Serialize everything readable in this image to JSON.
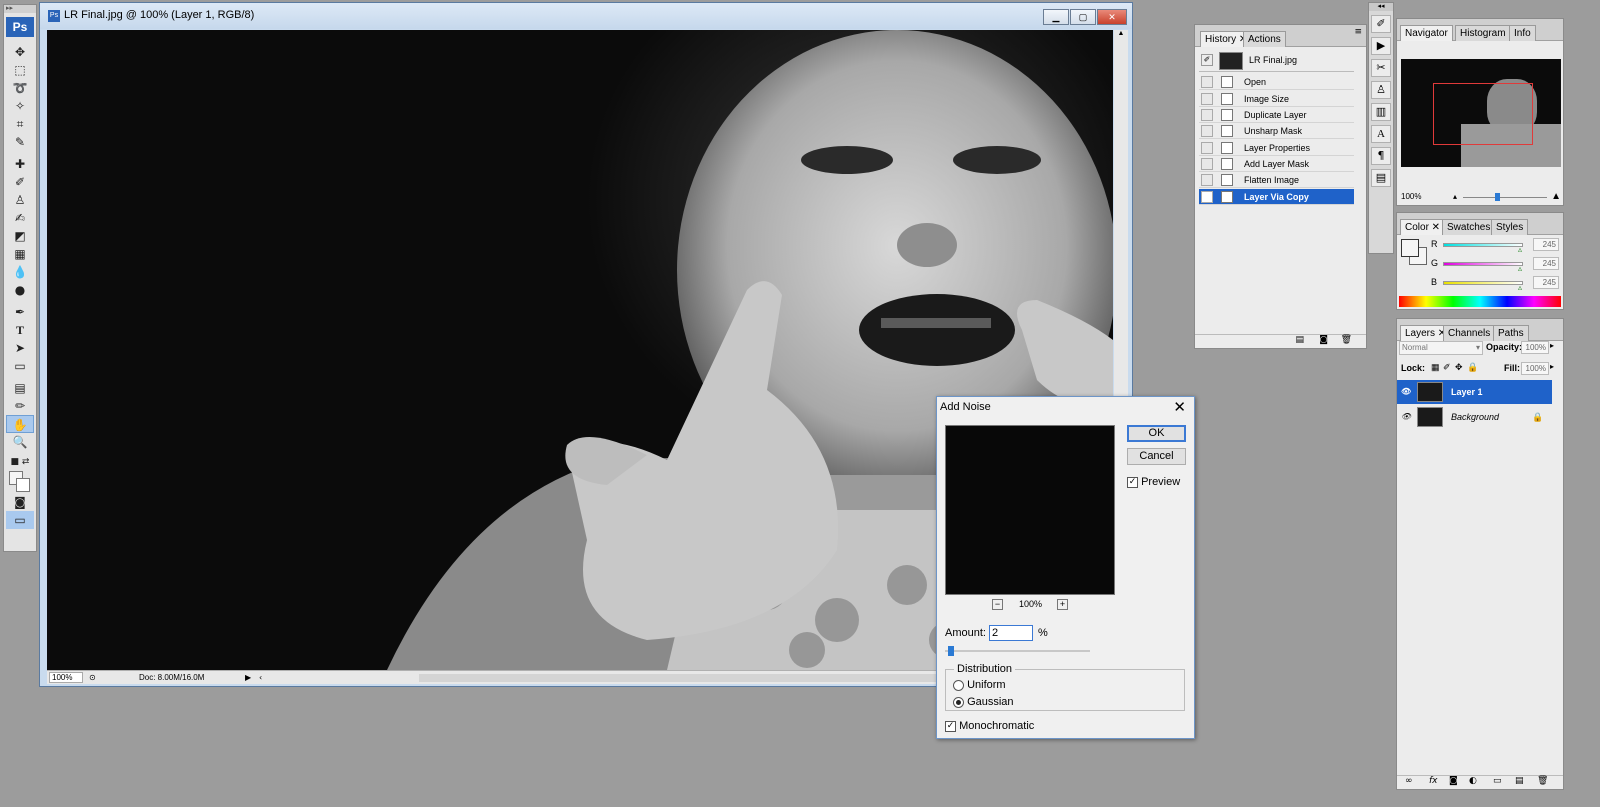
{
  "toolbox": {
    "logo": "Ps",
    "tools": [
      "move",
      "marquee",
      "lasso",
      "magic-wand",
      "crop",
      "slice",
      "healing",
      "brush",
      "stamp",
      "history-brush",
      "eraser",
      "gradient",
      "blur",
      "dodge",
      "pen",
      "type",
      "path-select",
      "shape",
      "notes",
      "eyedropper",
      "hand",
      "zoom"
    ]
  },
  "document": {
    "title": "LR Final.jpg @ 100% (Layer 1, RGB/8)",
    "zoom": "100%",
    "doc_info": "Doc: 8.00M/16.0M"
  },
  "history": {
    "tabs": [
      "History",
      "Actions"
    ],
    "snapshot": "LR Final.jpg",
    "items": [
      {
        "label": "Open",
        "selected": false
      },
      {
        "label": "Image Size",
        "selected": false
      },
      {
        "label": "Duplicate Layer",
        "selected": false
      },
      {
        "label": "Unsharp Mask",
        "selected": false
      },
      {
        "label": "Layer Properties",
        "selected": false
      },
      {
        "label": "Add Layer Mask",
        "selected": false
      },
      {
        "label": "Flatten Image",
        "selected": false
      },
      {
        "label": "Layer Via Copy",
        "selected": true
      }
    ]
  },
  "dialog": {
    "title": "Add Noise",
    "ok": "OK",
    "cancel": "Cancel",
    "preview_label": "Preview",
    "preview_checked": true,
    "preview_zoom": "100%",
    "amount_label": "Amount:",
    "amount_value": "2",
    "amount_unit": "%",
    "distribution_label": "Distribution",
    "uniform": "Uniform",
    "gaussian": "Gaussian",
    "distribution_selected": "Gaussian",
    "mono_label": "Monochromatic",
    "mono_checked": true
  },
  "navigator": {
    "tabs": [
      "Navigator",
      "Histogram",
      "Info"
    ],
    "zoom": "100%"
  },
  "color": {
    "tabs": [
      "Color",
      "Swatches",
      "Styles"
    ],
    "channels": [
      {
        "name": "R",
        "value": "245",
        "color": "#00c8c8"
      },
      {
        "name": "G",
        "value": "245",
        "color": "#e020e0"
      },
      {
        "name": "B",
        "value": "245",
        "color": "#e8e000"
      }
    ]
  },
  "layers": {
    "tabs": [
      "Layers",
      "Channels",
      "Paths"
    ],
    "blend_mode": "Normal",
    "opacity_label": "Opacity:",
    "opacity": "100%",
    "lock_label": "Lock:",
    "fill_label": "Fill:",
    "fill": "100%",
    "items": [
      {
        "name": "Layer 1",
        "selected": true
      },
      {
        "name": "Background",
        "selected": false
      }
    ]
  }
}
